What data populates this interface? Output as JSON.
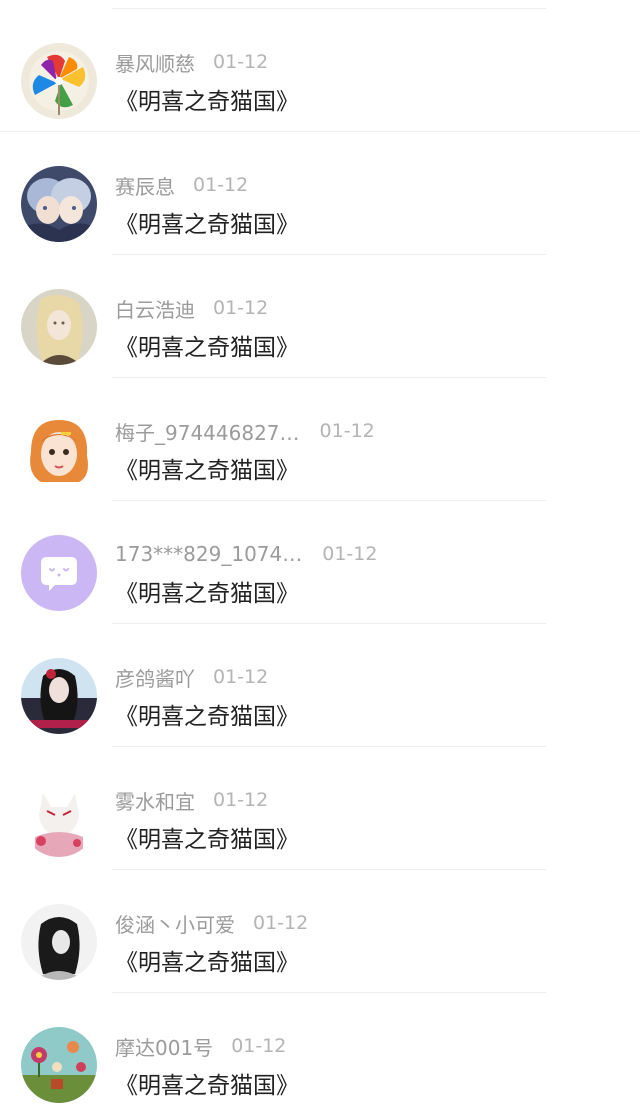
{
  "comments": [
    {
      "username": "暴风顺慈",
      "date": "01-12",
      "content": "《明喜之奇猫国》",
      "avatar_icon": "pinwheel-avatar-icon"
    },
    {
      "username": "赛辰息",
      "date": "01-12",
      "content": "《明喜之奇猫国》",
      "avatar_icon": "anime-boys-avatar-icon"
    },
    {
      "username": "白云浩迪",
      "date": "01-12",
      "content": "《明喜之奇猫国》",
      "avatar_icon": "girl-sketch-avatar-icon"
    },
    {
      "username": "梅子_974446827…",
      "date": "01-12",
      "content": "《明喜之奇猫国》",
      "avatar_icon": "cartoon-girl-avatar-icon"
    },
    {
      "username": "173***829_1074…",
      "date": "01-12",
      "content": "《明喜之奇猫国》",
      "avatar_icon": "chat-bubble-avatar-icon"
    },
    {
      "username": "彦鸽酱吖",
      "date": "01-12",
      "content": "《明喜之奇猫国》",
      "avatar_icon": "dark-girl-avatar-icon"
    },
    {
      "username": "雾水和宜",
      "date": "01-12",
      "content": "《明喜之奇猫国》",
      "avatar_icon": "fox-mask-avatar-icon"
    },
    {
      "username": "俊涵丶小可爱",
      "date": "01-12",
      "content": "《明喜之奇猫国》",
      "avatar_icon": "bw-portrait-avatar-icon"
    },
    {
      "username": "摩达001号",
      "date": "01-12",
      "content": "《明喜之奇猫国》",
      "avatar_icon": "garden-avatar-icon"
    }
  ]
}
